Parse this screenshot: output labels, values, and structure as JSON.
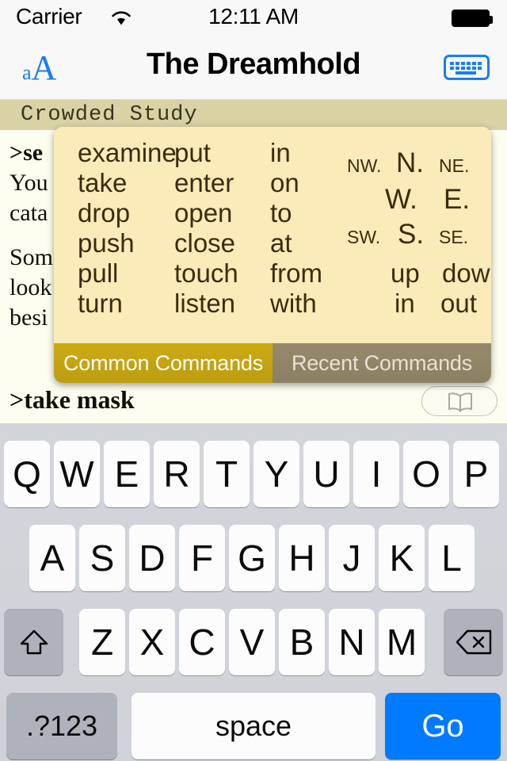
{
  "status_bar": {
    "carrier": "Carrier",
    "wifi_icon": "wifi-icon",
    "time": "12:11 AM",
    "battery_icon": "battery-full-icon"
  },
  "nav_bar": {
    "title": "The Dreamhold",
    "font_size_button": {
      "small": "a",
      "large": "A"
    },
    "keyboard_button_icon": "keyboard-icon"
  },
  "story": {
    "room_name": "Crowded Study",
    "lines": [
      {
        "text": ">se",
        "style": "command"
      },
      {
        "text": "You",
        "style": "normal"
      },
      {
        "text": "cata",
        "style": "normal"
      },
      {
        "text": "",
        "style": "blank"
      },
      {
        "text": "Som",
        "style": "normal"
      },
      {
        "text": "look",
        "style": "normal"
      },
      {
        "text": "besi",
        "style": "normal"
      }
    ],
    "prompt": ">take mask",
    "bookmark_button_icon": "open-book-icon"
  },
  "command_popup": {
    "columns": [
      [
        "examine",
        "take",
        "drop",
        "push",
        "pull",
        "turn"
      ],
      [
        "put",
        "enter",
        "open",
        "close",
        "touch",
        "listen"
      ],
      [
        "in",
        "on",
        "to",
        "at",
        "from",
        "with"
      ]
    ],
    "compass": {
      "nw": "NW.",
      "n": "N.",
      "ne": "NE.",
      "w": "W.",
      "e": "E.",
      "sw": "SW.",
      "s": "S.",
      "se": "SE."
    },
    "extra_directions": {
      "up": "up",
      "down": "down",
      "in": "in",
      "out": "out"
    },
    "tabs": [
      {
        "label": "Common Commands",
        "active": true
      },
      {
        "label": "Recent Commands",
        "active": false
      }
    ],
    "colors": {
      "background": "#fbebb8",
      "active_tab": "#c9a814",
      "inactive_tab": "#8e8467"
    }
  },
  "keyboard": {
    "row1": [
      "Q",
      "W",
      "E",
      "R",
      "T",
      "Y",
      "U",
      "I",
      "O",
      "P"
    ],
    "row2": [
      "A",
      "S",
      "D",
      "F",
      "G",
      "H",
      "J",
      "K",
      "L"
    ],
    "row3": [
      "Z",
      "X",
      "C",
      "V",
      "B",
      "N",
      "M"
    ],
    "shift_icon": "shift-arrow-icon",
    "backspace_icon": "backspace-icon",
    "numeric_key": ".?123",
    "space_key": "space",
    "return_key": "Go",
    "return_color": "#007aff"
  }
}
